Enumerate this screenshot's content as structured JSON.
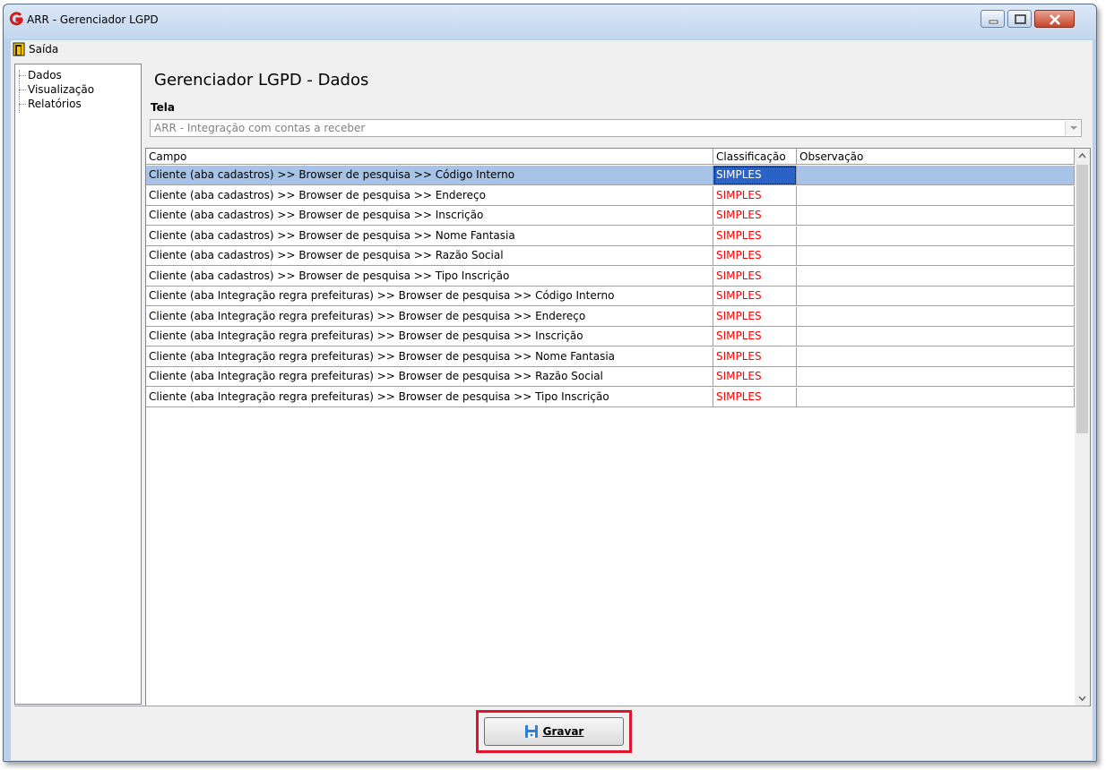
{
  "window": {
    "title": "ARR - Gerenciador LGPD"
  },
  "menu": {
    "exit_label": "Saída"
  },
  "tree": {
    "items": [
      {
        "label": "Dados"
      },
      {
        "label": "Visualização"
      },
      {
        "label": "Relatórios"
      }
    ]
  },
  "main": {
    "title": "Gerenciador LGPD - Dados",
    "tela_label": "Tela",
    "tela_value": "ARR - Integração com contas a receber"
  },
  "grid": {
    "columns": [
      "Campo",
      "Classificação",
      "Observação"
    ],
    "rows": [
      {
        "campo": "Cliente (aba cadastros) >> Browser de pesquisa >> Código Interno",
        "classificacao": "SIMPLES",
        "observacao": ""
      },
      {
        "campo": "Cliente (aba cadastros) >> Browser de pesquisa >> Endereço",
        "classificacao": "SIMPLES",
        "observacao": ""
      },
      {
        "campo": "Cliente (aba cadastros) >> Browser de pesquisa >> Inscrição",
        "classificacao": "SIMPLES",
        "observacao": ""
      },
      {
        "campo": "Cliente (aba cadastros) >> Browser de pesquisa >> Nome Fantasia",
        "classificacao": "SIMPLES",
        "observacao": ""
      },
      {
        "campo": "Cliente (aba cadastros) >> Browser de pesquisa >> Razão Social",
        "classificacao": "SIMPLES",
        "observacao": ""
      },
      {
        "campo": "Cliente (aba cadastros) >> Browser de pesquisa >> Tipo Inscrição",
        "classificacao": "SIMPLES",
        "observacao": ""
      },
      {
        "campo": "Cliente (aba Integração regra prefeituras) >> Browser de pesquisa >> Código Interno",
        "classificacao": "SIMPLES",
        "observacao": ""
      },
      {
        "campo": "Cliente (aba Integração regra prefeituras) >> Browser de pesquisa >> Endereço",
        "classificacao": "SIMPLES",
        "observacao": ""
      },
      {
        "campo": "Cliente (aba Integração regra prefeituras) >> Browser de pesquisa >> Inscrição",
        "classificacao": "SIMPLES",
        "observacao": ""
      },
      {
        "campo": "Cliente (aba Integração regra prefeituras) >> Browser de pesquisa >> Nome Fantasia",
        "classificacao": "SIMPLES",
        "observacao": ""
      },
      {
        "campo": "Cliente (aba Integração regra prefeituras) >> Browser de pesquisa >> Razão Social",
        "classificacao": "SIMPLES",
        "observacao": ""
      },
      {
        "campo": "Cliente (aba Integração regra prefeituras) >> Browser de pesquisa >> Tipo Inscrição",
        "classificacao": "SIMPLES",
        "observacao": ""
      }
    ],
    "selected_row": 0
  },
  "footer": {
    "save_label": "Gravar"
  },
  "colors": {
    "classification_text": "#ff0000",
    "selection_row": "#a8c3e8",
    "selection_cell": "#2a62c6",
    "highlight_box": "#e0142a"
  }
}
